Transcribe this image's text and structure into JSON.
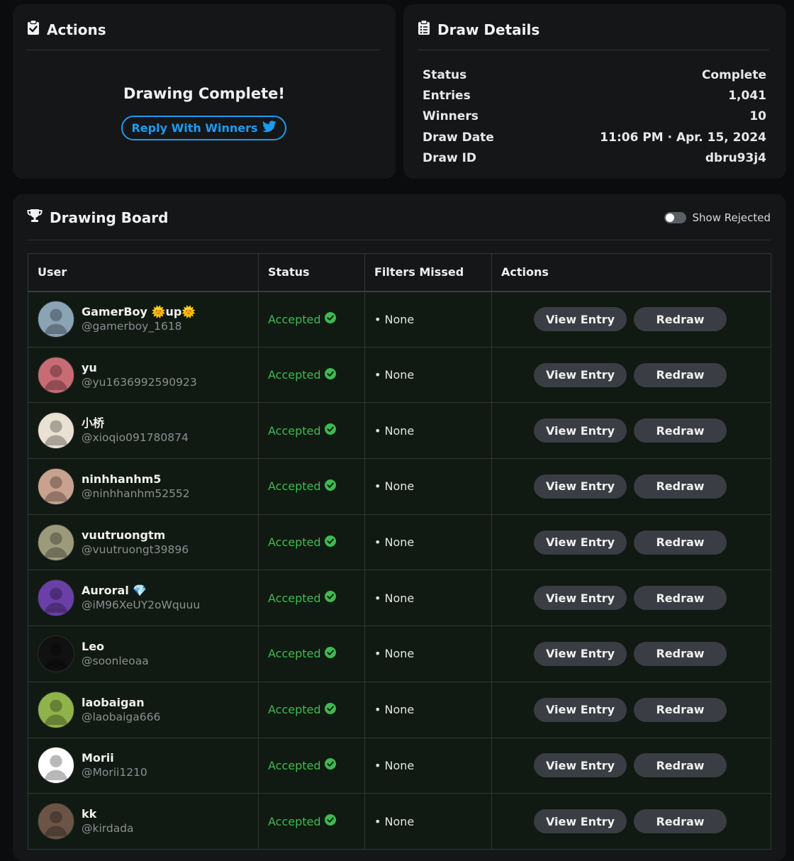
{
  "actions": {
    "title": "Actions",
    "complete_text": "Drawing Complete!",
    "reply_label": "Reply With Winners"
  },
  "details": {
    "title": "Draw Details",
    "rows": [
      {
        "label": "Status",
        "value": "Complete"
      },
      {
        "label": "Entries",
        "value": "1,041"
      },
      {
        "label": "Winners",
        "value": "10"
      },
      {
        "label": "Draw Date",
        "value": "11:06 PM · Apr. 15, 2024"
      },
      {
        "label": "Draw ID",
        "value": "dbru93j4"
      }
    ]
  },
  "board": {
    "title": "Drawing Board",
    "show_rejected_label": "Show Rejected",
    "show_rejected_on": false,
    "columns": [
      "User",
      "Status",
      "Filters Missed",
      "Actions"
    ],
    "view_label": "View Entry",
    "redraw_label": "Redraw",
    "rows": [
      {
        "name": "GamerBoy 🌞up🌞",
        "handle": "@gamerboy_1618",
        "status": "Accepted",
        "filters": "• None",
        "avatar": "#8aa3b5"
      },
      {
        "name": "yu",
        "handle": "@yu1636992590923",
        "status": "Accepted",
        "filters": "• None",
        "avatar": "#c96b73"
      },
      {
        "name": "小桥",
        "handle": "@xioqio091780874",
        "status": "Accepted",
        "filters": "• None",
        "avatar": "#e9e1d3"
      },
      {
        "name": "ninhhanhm5",
        "handle": "@ninhhanhm52552",
        "status": "Accepted",
        "filters": "• None",
        "avatar": "#c9a28f"
      },
      {
        "name": "vuutruongtm",
        "handle": "@vuutruongt39896",
        "status": "Accepted",
        "filters": "• None",
        "avatar": "#9b9a7a"
      },
      {
        "name": "Auroral 💎",
        "handle": "@iM96XeUY2oWquuu",
        "status": "Accepted",
        "filters": "• None",
        "avatar": "#6a3fa8"
      },
      {
        "name": "Leo",
        "handle": "@soonleoaa",
        "status": "Accepted",
        "filters": "• None",
        "avatar": "#111111"
      },
      {
        "name": "laobaigan",
        "handle": "@laobaiga666",
        "status": "Accepted",
        "filters": "• None",
        "avatar": "#8fb24a"
      },
      {
        "name": "Morii",
        "handle": "@Morii1210",
        "status": "Accepted",
        "filters": "• None",
        "avatar": "#ffffff"
      },
      {
        "name": "kk",
        "handle": "@kirdada",
        "status": "Accepted",
        "filters": "• None",
        "avatar": "#6b5446"
      }
    ]
  },
  "colors": {
    "accent_blue": "#1d9bf0",
    "accepted_green": "#3fb950"
  }
}
